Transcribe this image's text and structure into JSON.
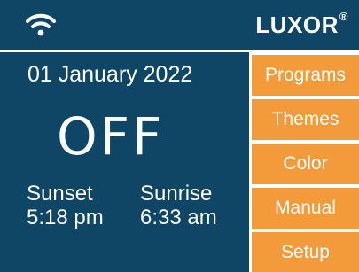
{
  "header": {
    "wifi_icon": "wifi-icon",
    "brand": "LUXOR",
    "brand_mark": "®"
  },
  "status": {
    "date": "01 January 2022",
    "state": "OFF"
  },
  "sun_times": {
    "sunset_label": "Sunset",
    "sunset_time": "5:18 pm",
    "sunrise_label": "Sunrise",
    "sunrise_time": "6:33 am"
  },
  "menu": {
    "items": [
      {
        "label": "Programs"
      },
      {
        "label": "Themes"
      },
      {
        "label": "Color"
      },
      {
        "label": "Manual"
      },
      {
        "label": "Setup"
      }
    ]
  },
  "colors": {
    "background": "#0f4666",
    "accent": "#f39a3b",
    "text": "#ffffff"
  }
}
